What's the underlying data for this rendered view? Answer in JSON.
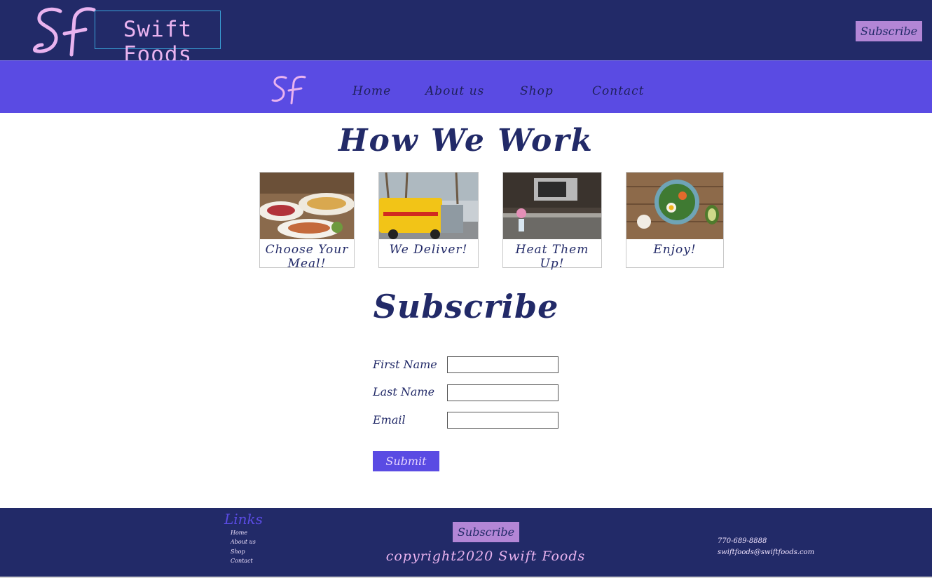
{
  "colors": {
    "header_bg": "#222a68",
    "nav_bg": "#5a4be3",
    "accent_pink": "#e9b3ef",
    "button_lavender": "#b386d6",
    "text_navy": "#222a68"
  },
  "header": {
    "logo_text": "SF",
    "brand_name": "Swift Foods",
    "subscribe_label": "Subscribe"
  },
  "nav": {
    "logo_text": "SF",
    "links": [
      "Home",
      "About us",
      "Shop",
      "Contact"
    ]
  },
  "how_we_work": {
    "title": "How We Work",
    "cards": [
      {
        "caption": "Choose Your Meal!",
        "image": "buffet-food-photo"
      },
      {
        "caption": "We Deliver!",
        "image": "delivery-van-photo"
      },
      {
        "caption": "Heat Them Up!",
        "image": "kitchen-microwave-photo"
      },
      {
        "caption": "Enjoy!",
        "image": "salad-bowl-photo"
      }
    ]
  },
  "subscribe_form": {
    "title": "Subscribe",
    "fields": [
      {
        "label": "First Name",
        "value": ""
      },
      {
        "label": "Last Name",
        "value": ""
      },
      {
        "label": "Email",
        "value": ""
      }
    ],
    "submit_label": "Submit"
  },
  "footer": {
    "links_title": "Links",
    "links": [
      "Home",
      "About us",
      "Shop",
      "Contact"
    ],
    "subscribe_label": "Subscribe",
    "copyright": "copyright2020 Swift Foods",
    "phone": "770-689-8888",
    "email": "swiftfoods@swiftfoods.com"
  }
}
